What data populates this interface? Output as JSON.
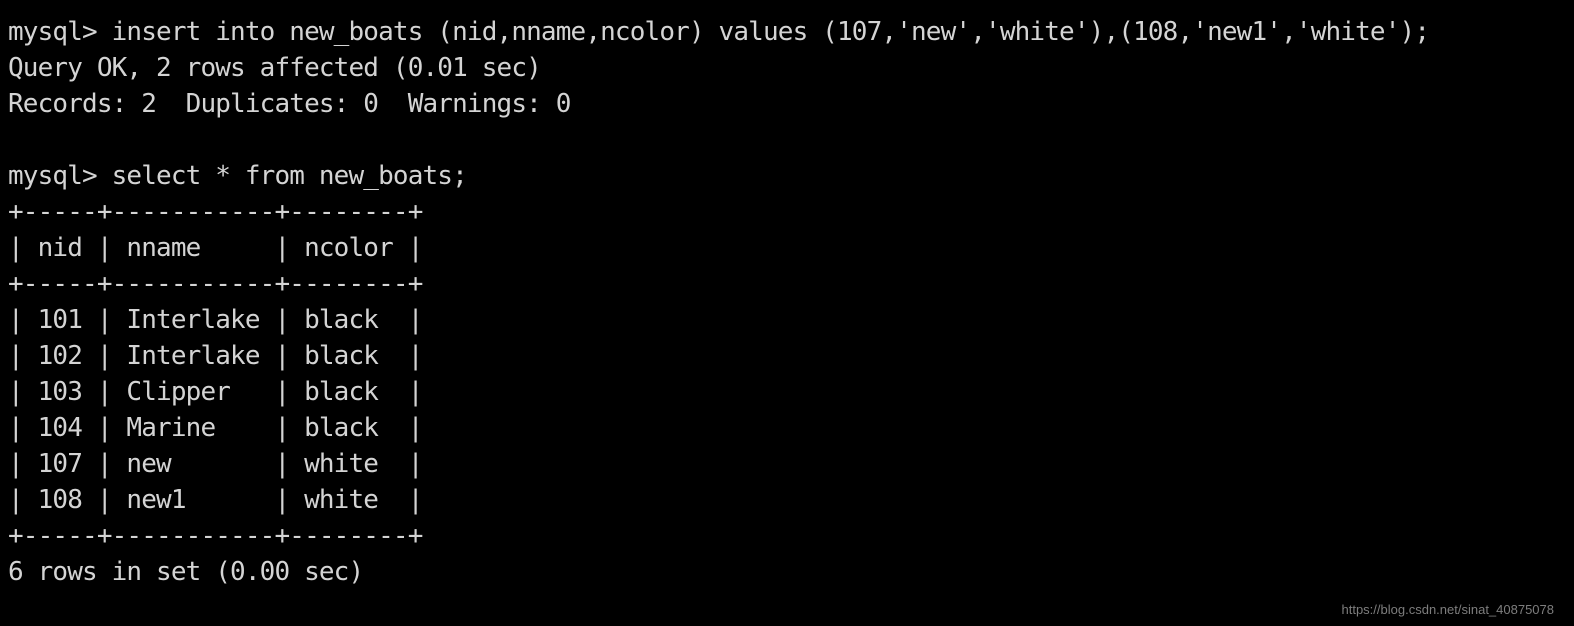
{
  "terminal": {
    "background_color": "#000000",
    "text_color": "#d4d4d4",
    "prompt": "mysql>",
    "lines": [
      {
        "id": "insert-command",
        "name": "terminal-line-insert-command",
        "text": "mysql> insert into new_boats (nid,nname,ncolor) values (107,'new','white'),(108,'new1','white');"
      },
      {
        "id": "insert-result",
        "name": "terminal-line-insert-result",
        "text": "Query OK, 2 rows affected (0.01 sec)"
      },
      {
        "id": "insert-stats",
        "name": "terminal-line-insert-stats",
        "text": "Records: 2  Duplicates: 0  Warnings: 0"
      },
      {
        "id": "blank-1",
        "name": "terminal-line-blank",
        "text": " "
      },
      {
        "id": "select-command",
        "name": "terminal-line-select-command",
        "text": "mysql> select * from new_boats;"
      },
      {
        "id": "table-top-border",
        "name": "terminal-line-table-top-border",
        "text": "+-----+-----------+--------+"
      },
      {
        "id": "table-header",
        "name": "terminal-line-table-header",
        "text": "| nid | nname     | ncolor |"
      },
      {
        "id": "table-header-border",
        "name": "terminal-line-table-header-border",
        "text": "+-----+-----------+--------+"
      },
      {
        "id": "row-101",
        "name": "terminal-line-table-row",
        "text": "| 101 | Interlake | black  |"
      },
      {
        "id": "row-102",
        "name": "terminal-line-table-row",
        "text": "| 102 | Interlake | black  |"
      },
      {
        "id": "row-103",
        "name": "terminal-line-table-row",
        "text": "| 103 | Clipper   | black  |"
      },
      {
        "id": "row-104",
        "name": "terminal-line-table-row",
        "text": "| 104 | Marine    | black  |"
      },
      {
        "id": "row-107",
        "name": "terminal-line-table-row",
        "text": "| 107 | new       | white  |"
      },
      {
        "id": "row-108",
        "name": "terminal-line-table-row",
        "text": "| 108 | new1      | white  |"
      },
      {
        "id": "table-bottom-border",
        "name": "terminal-line-table-bottom-border",
        "text": "+-----+-----------+--------+"
      },
      {
        "id": "select-result",
        "name": "terminal-line-select-result",
        "text": "6 rows in set (0.00 sec)"
      }
    ],
    "result_table": {
      "columns": [
        "nid",
        "nname",
        "ncolor"
      ],
      "rows": [
        [
          "101",
          "Interlake",
          "black"
        ],
        [
          "102",
          "Interlake",
          "black"
        ],
        [
          "103",
          "Clipper",
          "black"
        ],
        [
          "104",
          "Marine",
          "black"
        ],
        [
          "107",
          "new",
          "white"
        ],
        [
          "108",
          "new1",
          "white"
        ]
      ],
      "row_count_label": "6 rows in set (0.00 sec)"
    }
  },
  "watermark": {
    "text": "https://blog.csdn.net/sinat_40875078",
    "color": "#7d7d7d"
  }
}
